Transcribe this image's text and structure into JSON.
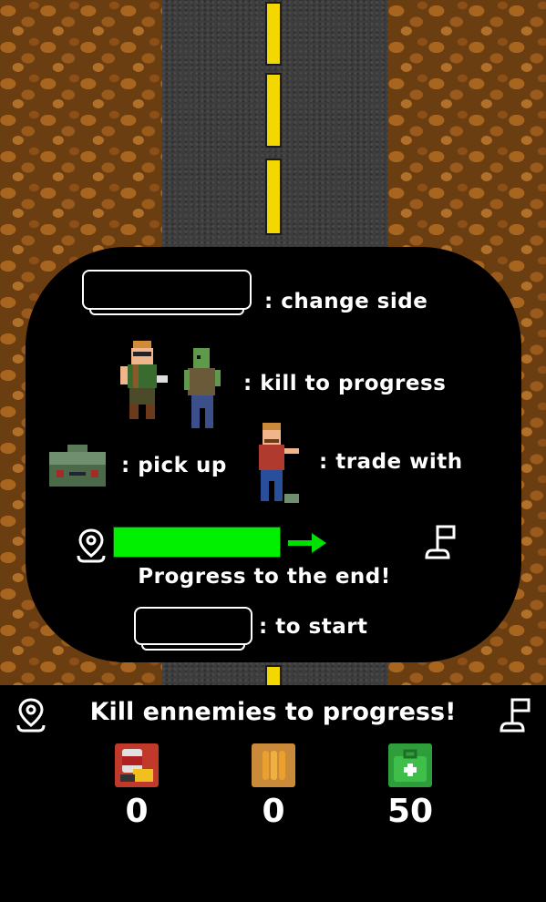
{
  "tutorial": {
    "change_side": ": change side",
    "kill_to_progress": ": kill to progress",
    "pick_up": ": pick up",
    "trade_with": ": trade with",
    "progress_caption": "Progress to the end!",
    "to_start": ": to start",
    "progress_fraction": 0.5
  },
  "hud": {
    "message": "Kill ennemies to progress!",
    "food_count": "0",
    "ammo_count": "0",
    "health_count": "50"
  },
  "icons": {
    "start": "location-pin-icon",
    "end": "finish-flag-icon",
    "arrow": "arrow-right-icon",
    "food": "canned-food-icon",
    "ammo": "bullets-icon",
    "health": "medkit-icon"
  },
  "colors": {
    "progress": "#00f000",
    "road_line": "#f2d800",
    "food_bg": "#c0392b",
    "ammo_bg": "#c98a3a",
    "health_bg": "#2e9e3a"
  }
}
